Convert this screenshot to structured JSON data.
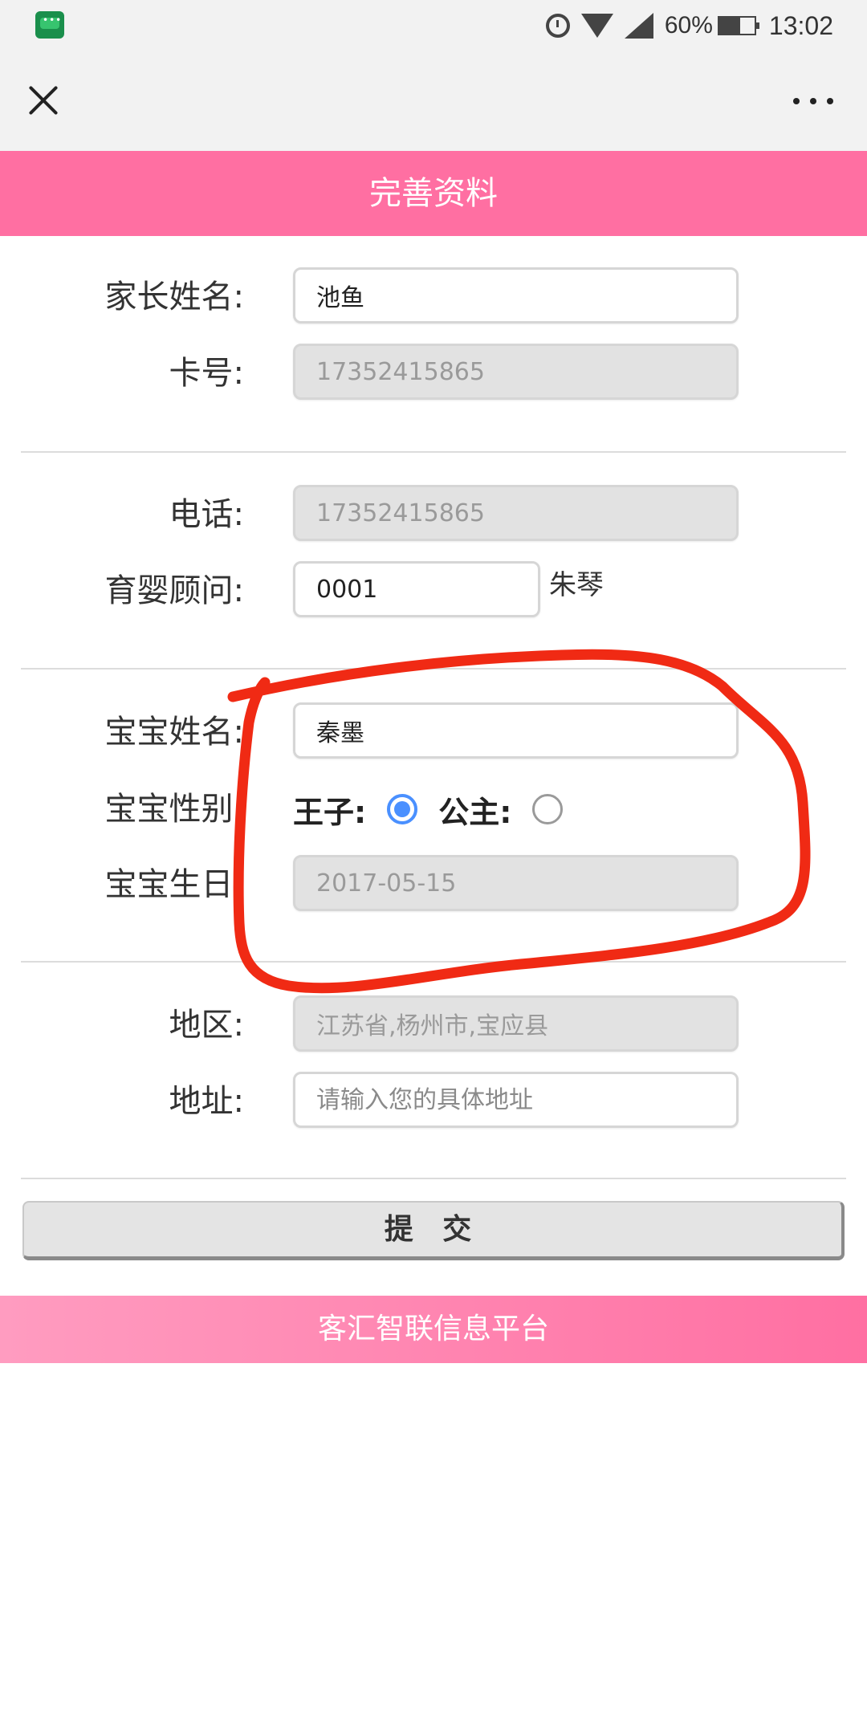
{
  "status_bar": {
    "battery": "60%",
    "battery_level": 0.6,
    "time": "13:02"
  },
  "header": {
    "title": "完善资料"
  },
  "form": {
    "parent_name": {
      "label": "家长姓名:",
      "value": "池鱼"
    },
    "card_number": {
      "label": "卡号:",
      "value": "17352415865"
    },
    "phone": {
      "label": "电话:",
      "value": "17352415865"
    },
    "advisor": {
      "label": "育婴顾问:",
      "value": "0001",
      "name": "朱琴"
    },
    "baby_name": {
      "label": "宝宝姓名:",
      "value": "秦墨"
    },
    "baby_gender": {
      "label": "宝宝性别:",
      "option_prince": "王子:",
      "option_princess": "公主:",
      "selected": "prince"
    },
    "baby_birthday": {
      "label": "宝宝生日:",
      "value": "2017-05-15"
    },
    "region": {
      "label": "地区:",
      "value": "江苏省,杨州市,宝应县"
    },
    "address": {
      "label": "地址:",
      "placeholder": "请输入您的具体地址"
    },
    "submit_label": "提 交"
  },
  "footer": {
    "text": "客汇智联信息平台"
  },
  "colors": {
    "brand_pink": "#ff6fa2",
    "radio_blue": "#4a90ff",
    "annotation_red": "#f02a14"
  }
}
